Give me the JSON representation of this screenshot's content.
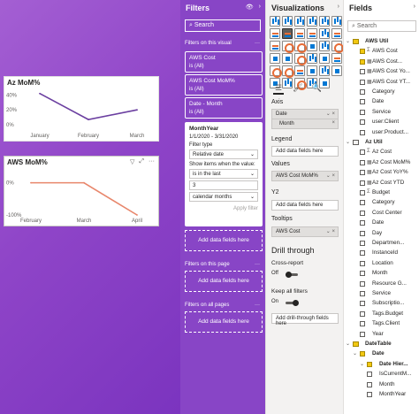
{
  "visuals": [
    {
      "title": "Az MoM%",
      "yticks": [
        "40%",
        "20%",
        "0%"
      ],
      "xticks": [
        "January",
        "February",
        "March"
      ],
      "color": "#6b3fa0"
    },
    {
      "title": "AWS MoM%",
      "header_icons": [
        "filter-icon",
        "focus-mode-icon",
        "more-options-icon"
      ],
      "header_glyphs": [
        "▽",
        "⤢",
        "···"
      ],
      "yticks": [
        "0%",
        "-100%"
      ],
      "xticks": [
        "February",
        "March",
        "April"
      ],
      "color": "#e8866b"
    }
  ],
  "chart_data": [
    {
      "type": "line",
      "title": "Az MoM%",
      "categories": [
        "January",
        "February",
        "March"
      ],
      "series": [
        {
          "values": [
            42,
            7,
            20
          ]
        }
      ],
      "ylim": [
        0,
        50
      ]
    },
    {
      "type": "line",
      "title": "AWS MoM%",
      "categories": [
        "February",
        "March",
        "April"
      ],
      "series": [
        {
          "values": [
            0,
            0,
            -100
          ]
        }
      ],
      "ylim": [
        -100,
        10
      ]
    }
  ],
  "filters": {
    "title": "Filters",
    "icons": [
      "eye-icon",
      "collapse-icon"
    ],
    "icon_glyphs": [
      "👁",
      "›"
    ],
    "search_placeholder": "Search",
    "search_icon": "⌕",
    "section_visual": "Filters on this visual",
    "section_page": "Filters on this page",
    "section_all": "Filters on all pages",
    "more": "···",
    "cards": [
      {
        "name": "AWS Cost",
        "sub": "is (All)"
      },
      {
        "name": "AWS Cost MoM%",
        "sub": "is (All)"
      },
      {
        "name": "Date - Month",
        "sub": "is (All)"
      }
    ],
    "monthyear": {
      "name": "MonthYear",
      "range": "1/1/2020 - 3/31/2020",
      "filter_type_label": "Filter type",
      "filter_type": "Relative date",
      "show_label": "Show items when the value:",
      "condition": "is in the last",
      "count": "3",
      "unit": "calendar months",
      "apply": "Apply filter"
    },
    "add_fields": "Add data fields here"
  },
  "viz": {
    "title": "Visualizations",
    "icons": [
      "collapse-icon"
    ],
    "icon_glyphs": [
      "›"
    ],
    "tabs": [
      "fields-tab-icon",
      "format-tab-icon",
      "analytics-tab-icon"
    ],
    "tab_glyphs": [
      "☰",
      "🖌",
      "🔍"
    ],
    "axis_label": "Axis",
    "axis_items": [
      "Date",
      "Month"
    ],
    "legend_label": "Legend",
    "values_label": "Values",
    "values_item": "AWS Cost MoM%",
    "y2_label": "Y2",
    "tooltips_label": "Tooltips",
    "tooltips_item": "AWS Cost",
    "add_fields": "Add data fields here",
    "drill_title": "Drill through",
    "cross_report": "Cross-report",
    "off": "Off",
    "keep_filters": "Keep all filters",
    "on": "On",
    "add_drill": "Add drill-through fields here"
  },
  "fields": {
    "title": "Fields",
    "icons": [
      "collapse-icon"
    ],
    "icon_glyphs": [
      "›"
    ],
    "search_placeholder": "Search",
    "rows": [
      {
        "label": "AWS Util",
        "level": 0,
        "table": true,
        "checked": true,
        "expanded": true
      },
      {
        "label": "AWS Cost",
        "level": 1,
        "checked": true,
        "icon": "Σ"
      },
      {
        "label": "AWS Cost...",
        "level": 1,
        "checked": true,
        "icon": "▦"
      },
      {
        "label": "AWS Cost Yo...",
        "level": 1,
        "checked": false,
        "icon": "▦"
      },
      {
        "label": "AWS Cost YT...",
        "level": 1,
        "checked": false,
        "icon": "▦"
      },
      {
        "label": "Category",
        "level": 1,
        "checked": false
      },
      {
        "label": "Date",
        "level": 1,
        "checked": false
      },
      {
        "label": "Service",
        "level": 1,
        "checked": false
      },
      {
        "label": "user:Client",
        "level": 1,
        "checked": false
      },
      {
        "label": "user:Product...",
        "level": 1,
        "checked": false
      },
      {
        "label": "Az Util",
        "level": 0,
        "table": true,
        "checked": false,
        "expanded": true
      },
      {
        "label": "Az Cost",
        "level": 1,
        "checked": false,
        "icon": "Σ"
      },
      {
        "label": "Az Cost MoM%",
        "level": 1,
        "checked": false,
        "icon": "▦"
      },
      {
        "label": "Az Cost YoY%",
        "level": 1,
        "checked": false,
        "icon": "▦"
      },
      {
        "label": "Az Cost YTD",
        "level": 1,
        "checked": false,
        "icon": "▦"
      },
      {
        "label": "Budget",
        "level": 1,
        "checked": false,
        "icon": "Σ"
      },
      {
        "label": "Category",
        "level": 1,
        "checked": false
      },
      {
        "label": "Cost Center",
        "level": 1,
        "checked": false
      },
      {
        "label": "Date",
        "level": 1,
        "checked": false
      },
      {
        "label": "Day",
        "level": 1,
        "checked": false
      },
      {
        "label": "Departmen...",
        "level": 1,
        "checked": false
      },
      {
        "label": "InstanceId",
        "level": 1,
        "checked": false
      },
      {
        "label": "Location",
        "level": 1,
        "checked": false
      },
      {
        "label": "Month",
        "level": 1,
        "checked": false
      },
      {
        "label": "Resource G...",
        "level": 1,
        "checked": false
      },
      {
        "label": "Service",
        "level": 1,
        "checked": false
      },
      {
        "label": "Subscriptio...",
        "level": 1,
        "checked": false
      },
      {
        "label": "Tags.Budget",
        "level": 1,
        "checked": false
      },
      {
        "label": "Tags.Client",
        "level": 1,
        "checked": false
      },
      {
        "label": "Year",
        "level": 1,
        "checked": false
      },
      {
        "label": "DateTable",
        "level": 0,
        "table": true,
        "checked": true,
        "expanded": true
      },
      {
        "label": "Date",
        "level": 1,
        "checked": true,
        "expanded": true,
        "bold": true
      },
      {
        "label": "Date Hier...",
        "level": 2,
        "checked": true,
        "expanded": true,
        "bold": true
      },
      {
        "label": "IsCurrentM...",
        "level": 2,
        "checked": false
      },
      {
        "label": "Month",
        "level": 2,
        "checked": false
      },
      {
        "label": "MonthYear",
        "level": 2,
        "checked": false
      }
    ]
  }
}
